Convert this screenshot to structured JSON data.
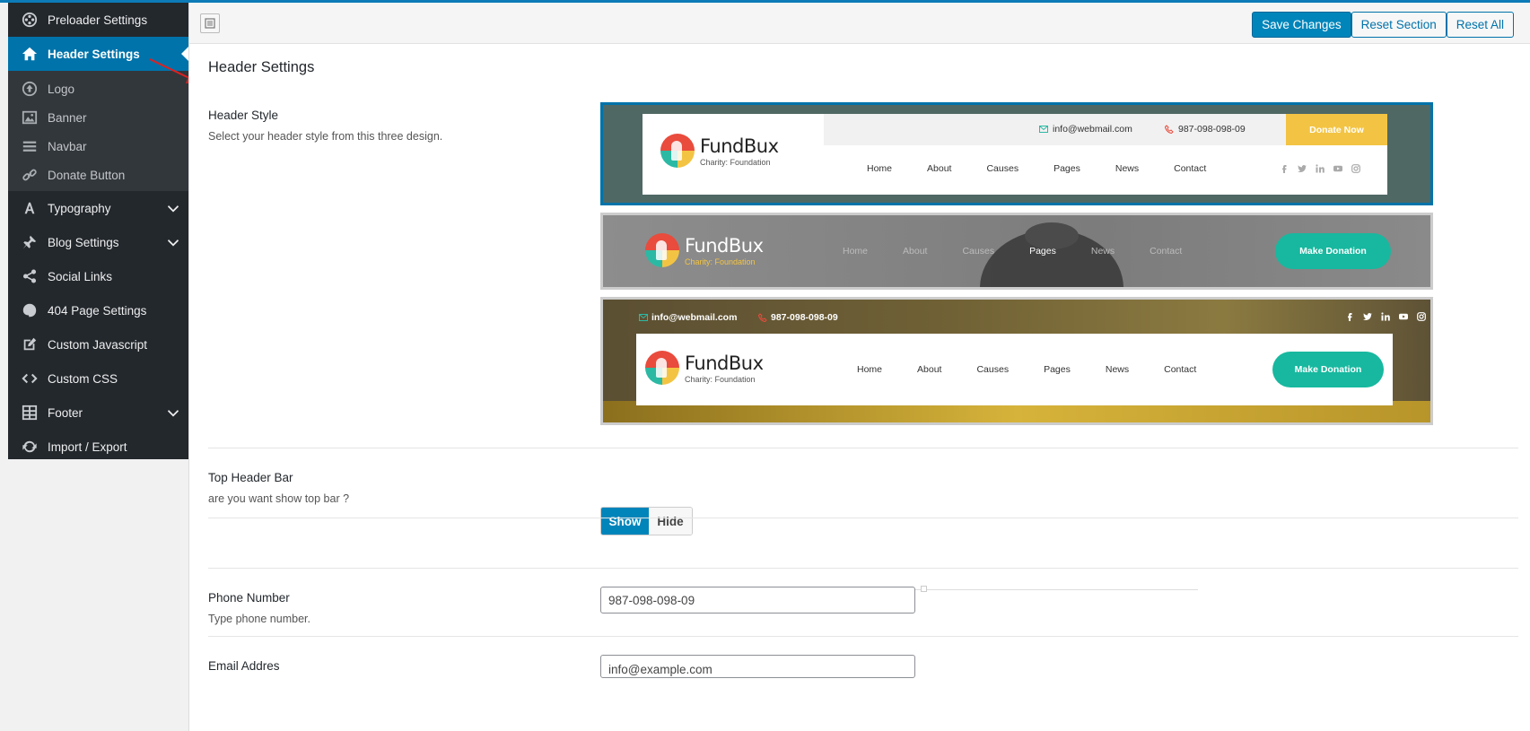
{
  "sidebar": {
    "items": [
      {
        "label": "Preloader Settings",
        "icon": "film-reel-icon"
      },
      {
        "label": "Header Settings",
        "icon": "home-icon",
        "active": true
      },
      {
        "label": "Typography",
        "icon": "font-icon"
      },
      {
        "label": "Blog Settings",
        "icon": "pin-icon"
      },
      {
        "label": "Social Links",
        "icon": "share-icon"
      },
      {
        "label": "404 Page Settings",
        "icon": "palette-icon"
      },
      {
        "label": "Custom Javascript",
        "icon": "edit-icon"
      },
      {
        "label": "Custom CSS",
        "icon": "code-icon"
      },
      {
        "label": "Footer",
        "icon": "grid-icon"
      },
      {
        "label": "Import / Export",
        "icon": "refresh-icon"
      }
    ],
    "subitems": [
      {
        "label": "Logo",
        "icon": "upload-icon"
      },
      {
        "label": "Banner",
        "icon": "image-icon"
      },
      {
        "label": "Navbar",
        "icon": "menu-icon"
      },
      {
        "label": "Donate Button",
        "icon": "link-icon"
      }
    ]
  },
  "toolbar": {
    "save_label": "Save Changes",
    "reset_section_label": "Reset Section",
    "reset_all_label": "Reset All"
  },
  "page": {
    "title": "Header Settings"
  },
  "header_style": {
    "label": "Header Style",
    "description": "Select your header style from this three design.",
    "selected_index": 0
  },
  "preview": {
    "brand": "FundBux",
    "tagline": "Charity: Foundation",
    "email": "info@webmail.com",
    "phone": "987-098-098-09",
    "donate_now": "Donate Now",
    "make_donation": "Make Donation",
    "menu": [
      "Home",
      "About",
      "Causes",
      "Pages",
      "News",
      "Contact"
    ]
  },
  "top_header_bar": {
    "label": "Top Header Bar",
    "description": "are you want show top bar ?",
    "show_label": "Show",
    "hide_label": "Hide",
    "value": "Show"
  },
  "phone_number": {
    "label": "Phone Number",
    "description": "Type phone number.",
    "value": "987-098-098-09"
  },
  "email_address": {
    "label": "Email Addres",
    "value": "info@example.com"
  },
  "colors": {
    "accent": "#0073aa",
    "sidebar_bg": "#23282d",
    "teal": "#17b89f",
    "yellow": "#f3c443"
  }
}
